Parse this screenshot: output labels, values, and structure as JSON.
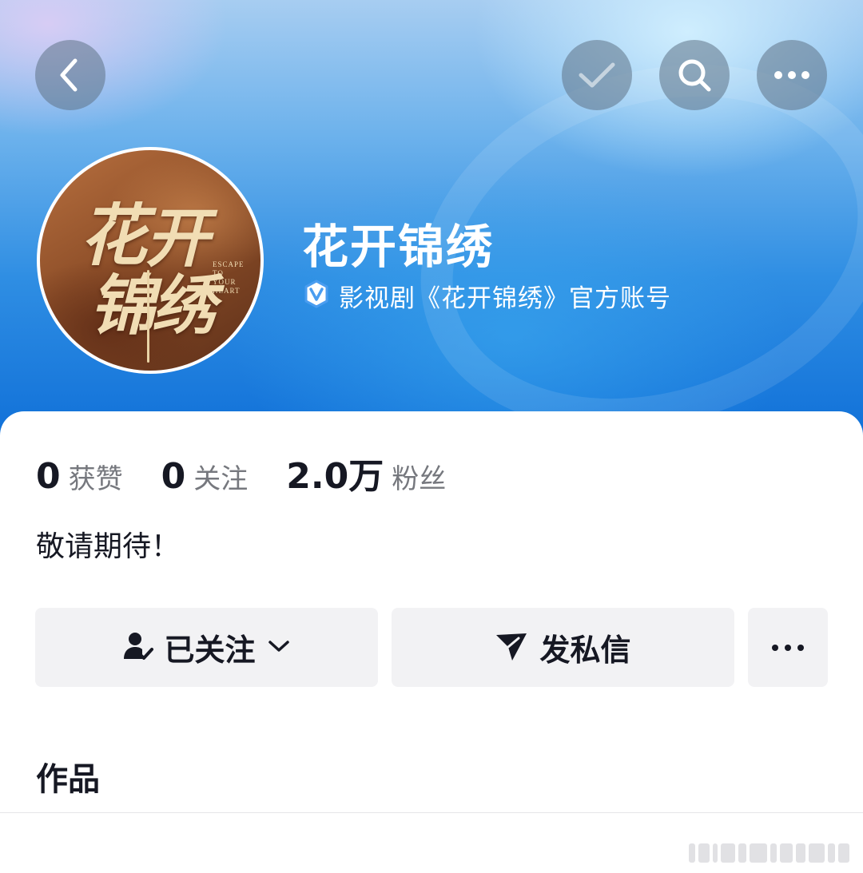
{
  "header": {
    "back_icon": "chevron-left-icon",
    "actions": [
      "check-icon",
      "search-icon",
      "more-horizontal-icon"
    ]
  },
  "profile": {
    "avatar_text": [
      "花",
      "开",
      "锦",
      "绣"
    ],
    "avatar_subtitle": [
      "ESCAPE",
      "TO",
      "YOUR",
      "HEART"
    ],
    "name": "花开锦绣",
    "verification": "影视剧《花开锦绣》官方账号",
    "verification_color": "#4a9df0"
  },
  "stats": [
    {
      "value": "0",
      "label": "获赞"
    },
    {
      "value": "0",
      "label": "关注"
    },
    {
      "value": "2.0万",
      "label": "粉丝"
    }
  ],
  "bio": "敬请期待！",
  "actions": {
    "follow_label": "已关注",
    "message_label": "发私信"
  },
  "section": {
    "works_title": "作品"
  },
  "colors": {
    "banner_top": "#a7cdf1",
    "banner_bottom": "#0f6fd8",
    "button_bg": "#f2f2f4",
    "text_primary": "#161823",
    "text_secondary": "#76787e"
  }
}
